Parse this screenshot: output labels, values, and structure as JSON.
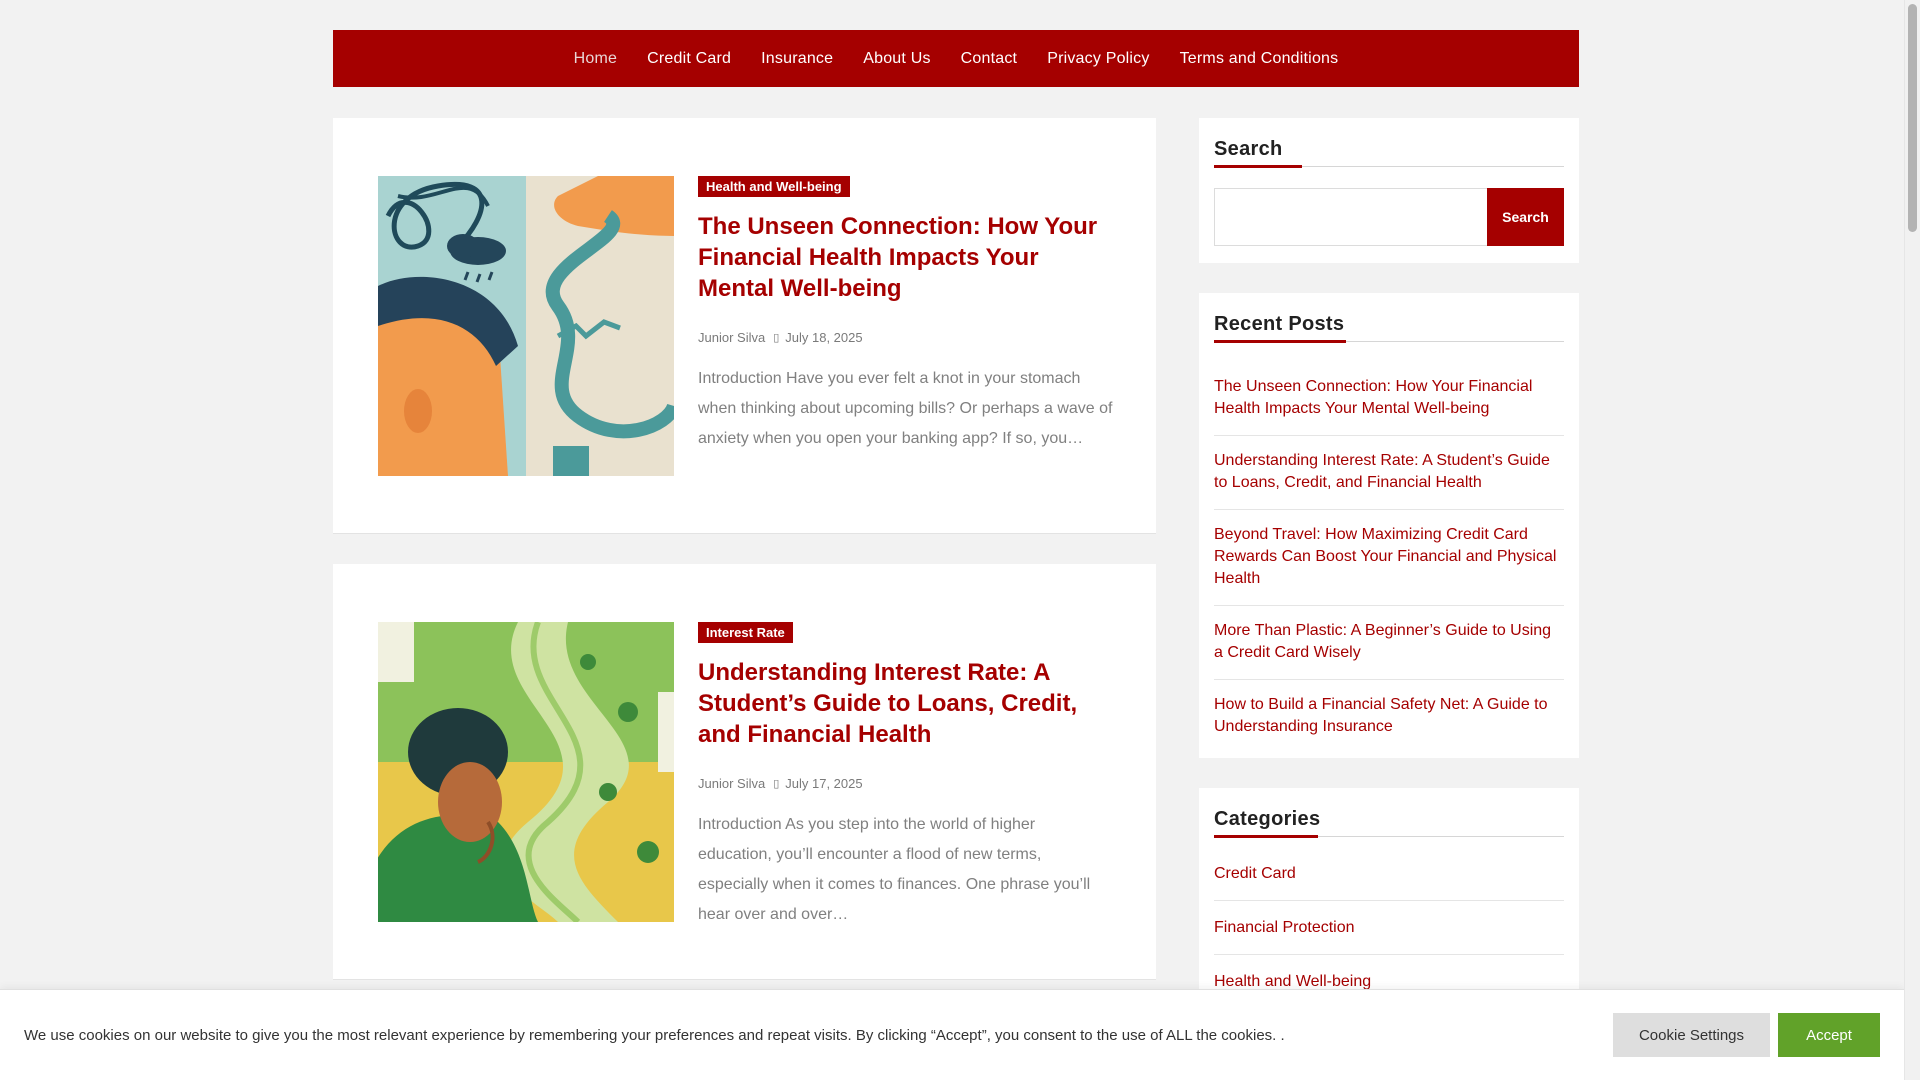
{
  "nav": {
    "items": [
      {
        "label": "Home",
        "active": true
      },
      {
        "label": "Credit Card"
      },
      {
        "label": "Insurance"
      },
      {
        "label": "About Us"
      },
      {
        "label": "Contact"
      },
      {
        "label": "Privacy Policy"
      },
      {
        "label": "Terms and Conditions"
      }
    ]
  },
  "posts": [
    {
      "category": "Health and Well-being",
      "title": "The Unseen Connection: How Your Financial Health Impacts Your Mental Well-being",
      "author": "Junior Silva",
      "date": "July 18, 2025",
      "excerpt": "Introduction Have you ever felt a knot in your stomach when thinking about upcoming bills? Or perhaps a wave of anxiety when you open your banking app? If so, you…"
    },
    {
      "category": "Interest Rate",
      "title": "Understanding Interest Rate: A Student’s Guide to Loans, Credit, and Financial Health",
      "author": "Junior Silva",
      "date": "July 17, 2025",
      "excerpt": "Introduction As you step into the world of higher education, you’ll encounter a flood of new terms, especially when it comes to finances. One phrase you’ll hear over and over…"
    }
  ],
  "sidebar": {
    "search": {
      "title": "Search",
      "placeholder": "",
      "button": "Search"
    },
    "recent": {
      "title": "Recent Posts",
      "items": [
        "The Unseen Connection: How Your Financial Health Impacts Your Mental Well-being",
        "Understanding Interest Rate: A Student’s Guide to Loans, Credit, and Financial Health",
        "Beyond Travel: How Maximizing Credit Card Rewards Can Boost Your Financial and Physical Health",
        "More Than Plastic: A Beginner’s Guide to Using a Credit Card Wisely",
        "How to Build a Financial Safety Net: A Guide to Understanding Insurance"
      ]
    },
    "categories": {
      "title": "Categories",
      "items": [
        "Credit Card",
        "Financial Protection",
        "Health and Well-being"
      ]
    }
  },
  "cookie": {
    "text": "We use cookies on our website to give you the most relevant experience by remembering your preferences and repeat visits. By clicking “Accept”, you consent to the use of ALL the cookies. .",
    "settings_label": "Cookie Settings",
    "accept_label": "Accept"
  },
  "colors": {
    "brand": "#a50000",
    "accept": "#61a229"
  }
}
